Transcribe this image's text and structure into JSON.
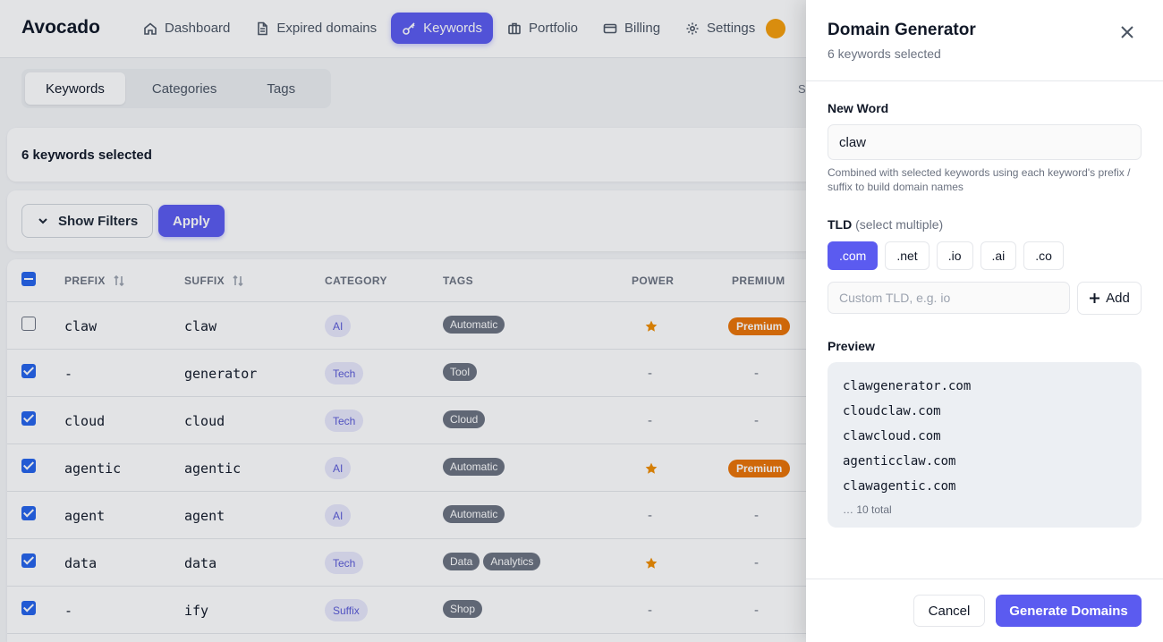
{
  "app": {
    "logo": "Avocado",
    "nav": [
      {
        "label": "Dashboard",
        "icon": "home-icon"
      },
      {
        "label": "Expired domains",
        "icon": "document-icon"
      },
      {
        "label": "Keywords",
        "icon": "key-icon",
        "active": true
      },
      {
        "label": "Portfolio",
        "icon": "briefcase-icon"
      },
      {
        "label": "Billing",
        "icon": "credit-card-icon"
      },
      {
        "label": "Settings",
        "icon": "gear-icon"
      }
    ],
    "tabs": [
      "Keywords",
      "Categories",
      "Tags"
    ],
    "tabs_right_hint": "S",
    "selection_text": "6 keywords selected",
    "show_filters_label": "Show Filters",
    "apply_label": "Apply",
    "table": {
      "headers": [
        "PREFIX",
        "SUFFIX",
        "CATEGORY",
        "TAGS",
        "POWER",
        "PREMIUM"
      ],
      "rows": [
        {
          "checked": false,
          "prefix": "claw",
          "suffix": "claw",
          "category": "AI",
          "tags": [
            "Automatic"
          ],
          "power": "star",
          "premium": "Premium"
        },
        {
          "checked": true,
          "prefix": "-",
          "suffix": "generator",
          "category": "Tech",
          "tags": [
            "Tool"
          ],
          "power": "-",
          "premium": "-"
        },
        {
          "checked": true,
          "prefix": "cloud",
          "suffix": "cloud",
          "category": "Tech",
          "tags": [
            "Cloud"
          ],
          "power": "-",
          "premium": "-"
        },
        {
          "checked": true,
          "prefix": "agentic",
          "suffix": "agentic",
          "category": "AI",
          "tags": [
            "Automatic"
          ],
          "power": "star",
          "premium": "Premium"
        },
        {
          "checked": true,
          "prefix": "agent",
          "suffix": "agent",
          "category": "AI",
          "tags": [
            "Automatic"
          ],
          "power": "-",
          "premium": "-"
        },
        {
          "checked": true,
          "prefix": "data",
          "suffix": "data",
          "category": "Tech",
          "tags": [
            "Data",
            "Analytics"
          ],
          "power": "star",
          "premium": "-"
        },
        {
          "checked": true,
          "prefix": "-",
          "suffix": "ify",
          "category": "Suffix",
          "tags": [
            "Shop"
          ],
          "power": "-",
          "premium": "-"
        }
      ]
    }
  },
  "drawer": {
    "title": "Domain Generator",
    "subtitle": "6 keywords selected",
    "new_word_label": "New Word",
    "new_word_value": "claw",
    "help_text": "Combined with selected keywords using each keyword's prefix / suffix to build domain names",
    "tld_label": "TLD",
    "tld_hint": "(select multiple)",
    "tlds": [
      {
        "label": ".com",
        "selected": true
      },
      {
        "label": ".net",
        "selected": false
      },
      {
        "label": ".io",
        "selected": false
      },
      {
        "label": ".ai",
        "selected": false
      },
      {
        "label": ".co",
        "selected": false
      }
    ],
    "custom_tld_placeholder": "Custom TLD, e.g. io",
    "add_label": "Add",
    "preview_label": "Preview",
    "preview_items": [
      "clawgenerator.com",
      "cloudclaw.com",
      "clawcloud.com",
      "agenticclaw.com",
      "clawagentic.com"
    ],
    "preview_total": "… 10 total",
    "cancel_label": "Cancel",
    "generate_label": "Generate Domains"
  },
  "colors": {
    "accent": "#5b5bf0",
    "checkbox": "#2563eb",
    "premium": "#ea7406",
    "star": "#f08c00"
  }
}
